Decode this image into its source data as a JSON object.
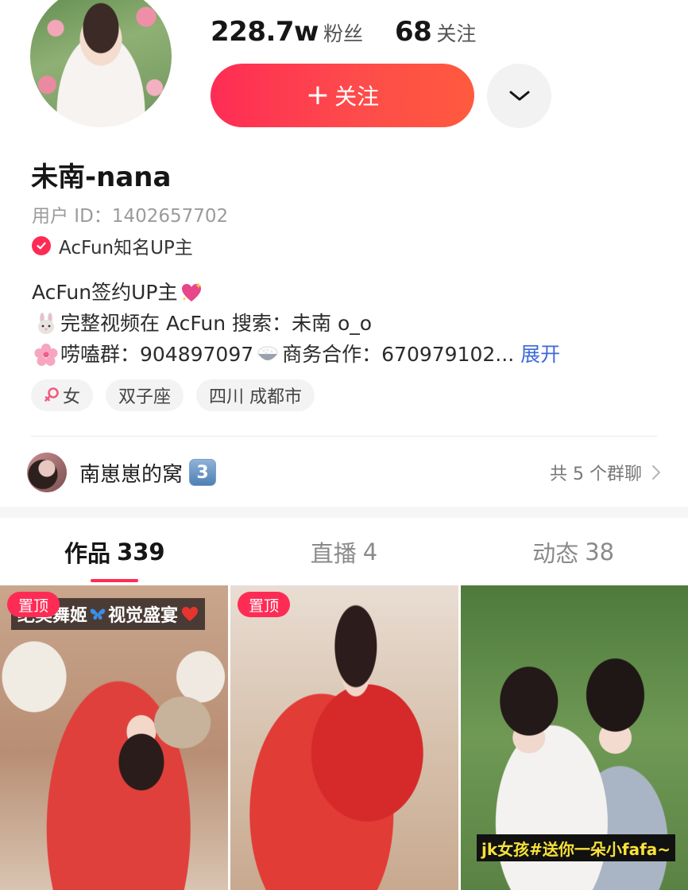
{
  "profile": {
    "followers_count": "228.7w",
    "followers_label": "粉丝",
    "following_count": "68",
    "following_label": "关注",
    "follow_button_label": "关注",
    "nickname": "未南-nana",
    "user_id": "用户 ID：1402657702",
    "verification": "AcFun知名UP主"
  },
  "bio": {
    "line1": "AcFun签约UP主",
    "line2": "完整视频在 AcFun 搜索：未南 o_o",
    "line3": "唠嗑群：904897097",
    "line3b": "商务合作：670979102...",
    "expand_label": "展开"
  },
  "tags": {
    "gender": "女",
    "zodiac": "双子座",
    "location": "四川 成都市"
  },
  "group": {
    "name": "南崽崽的窝",
    "badge": "3",
    "count_label": "共 5 个群聊"
  },
  "tabs": [
    {
      "label": "作品",
      "count": "339"
    },
    {
      "label": "直播",
      "count": "4"
    },
    {
      "label": "动态",
      "count": "38"
    }
  ],
  "videos": [
    {
      "pin_label": "置顶",
      "title_text": "绝美舞姬",
      "title_tail": "视觉盛宴"
    },
    {
      "pin_label": "置顶"
    },
    {
      "caption": "jk女孩#送你一朵小fafa~"
    }
  ],
  "colors": {
    "accent": "#fe2c55",
    "link": "#3d6ad6",
    "caption_text": "#f8e13a"
  },
  "icons": [
    "chevron-down-icon",
    "verified-check-icon",
    "sparkling-heart-emoji",
    "rabbit-emoji",
    "cherry-blossom-emoji",
    "rice-bowl-emoji",
    "female-symbol-icon",
    "chevron-right-icon",
    "butterfly-emoji",
    "heart-emoji"
  ]
}
